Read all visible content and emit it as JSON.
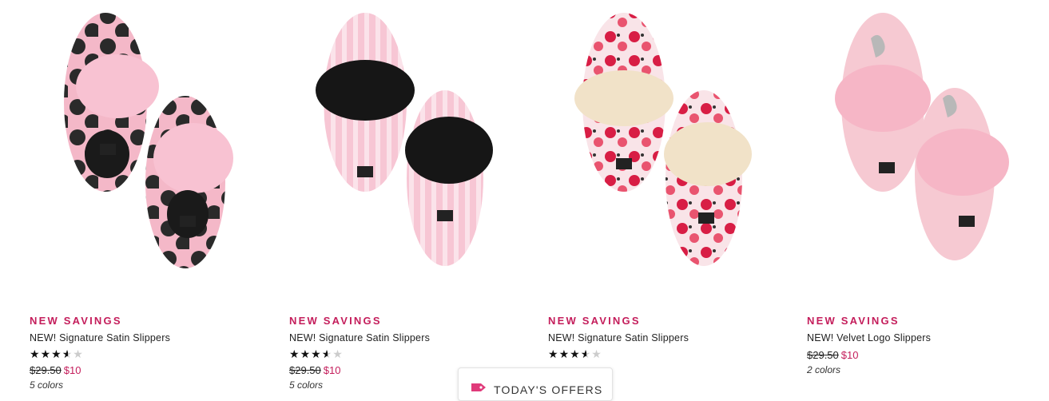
{
  "products": [
    {
      "badge": "NEW SAVINGS",
      "name": "NEW! Signature Satin Slippers",
      "rating": 3.5,
      "price_original": "$29.50",
      "price_sale": "$10",
      "colors": "5 colors",
      "image": "pink-polka-dot-slippers"
    },
    {
      "badge": "NEW SAVINGS",
      "name": "NEW! Signature Satin Slippers",
      "rating": 3.5,
      "price_original": "$29.50",
      "price_sale": "$10",
      "colors": "5 colors",
      "image": "pink-stripe-black-fur-slippers"
    },
    {
      "badge": "NEW SAVINGS",
      "name": "NEW! Signature Satin Slippers",
      "rating": 3.5,
      "image": "floral-cream-fur-slippers"
    },
    {
      "badge": "NEW SAVINGS",
      "name": "NEW! Velvet Logo Slippers",
      "price_original": "$29.50",
      "price_sale": "$10",
      "colors": "2 colors",
      "image": "pink-velvet-logo-slippers"
    }
  ],
  "offers_button": {
    "label": "TODAY'S OFFERS",
    "icon": "tag-icon"
  },
  "colors": {
    "accent": "#c41d5b",
    "star": "#111111",
    "star_off": "#cccccc"
  }
}
